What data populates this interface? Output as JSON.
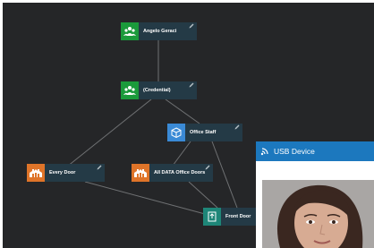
{
  "graph": {
    "nodes": [
      {
        "label": "Angelo Geraci",
        "icon": "group-icon",
        "color": "#1b9a3b"
      },
      {
        "label": "(Credential)",
        "icon": "group-icon",
        "color": "#1b9a3b"
      },
      {
        "label": "Office Staff",
        "icon": "package-icon",
        "color": "#3a8ad6"
      },
      {
        "label": "Every Door",
        "icon": "building-icon",
        "color": "#df7429"
      },
      {
        "label": "All DATA Office Doors",
        "icon": "building-icon",
        "color": "#df7429"
      },
      {
        "label": "Front Door",
        "icon": "door-icon",
        "color": "#1e8678"
      }
    ]
  },
  "usb_window": {
    "title": "USB Device",
    "icon": "wireless-signal-icon",
    "accent": "#1c78be"
  }
}
